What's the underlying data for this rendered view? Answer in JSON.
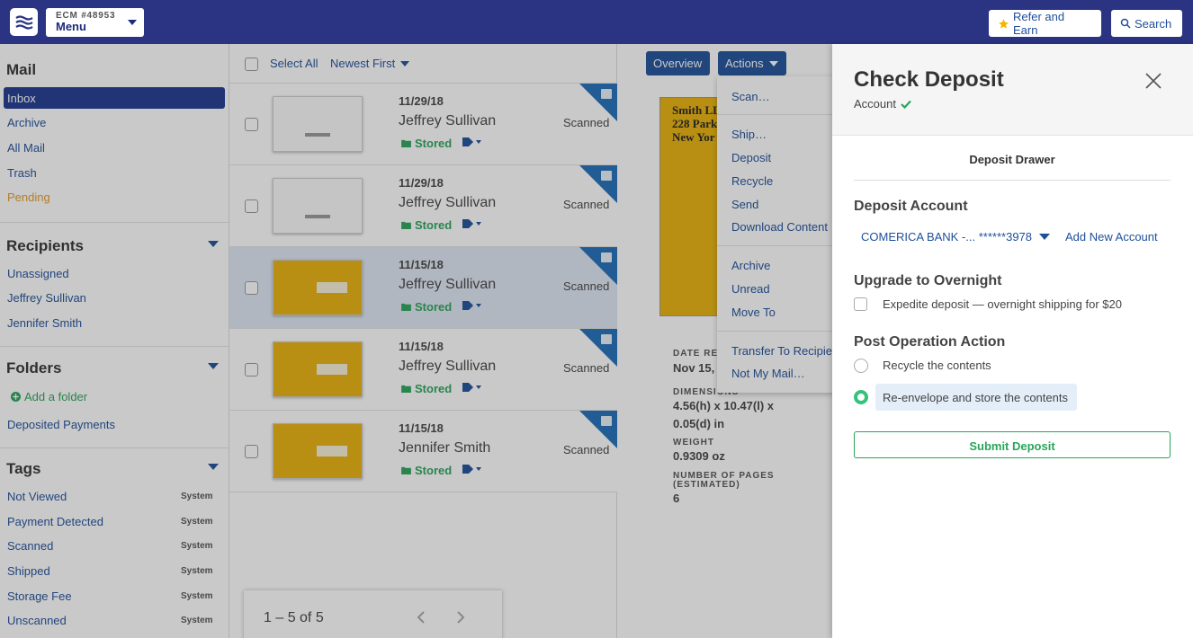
{
  "topbar": {
    "account_id": "ECM #48953",
    "menu_label": "Menu",
    "refer_label": "Refer and Earn",
    "search_label": "Search"
  },
  "sidebar": {
    "mail_title": "Mail",
    "mail_items": [
      "Inbox",
      "Archive",
      "All Mail",
      "Trash",
      "Pending"
    ],
    "recipients_title": "Recipients",
    "recipients": [
      "Unassigned",
      "Jeffrey Sullivan",
      "Jennifer Smith"
    ],
    "folders_title": "Folders",
    "add_folder": "Add a folder",
    "folders": [
      "Deposited Payments"
    ],
    "tags_title": "Tags",
    "tags": [
      {
        "name": "Not Viewed",
        "badge": "System"
      },
      {
        "name": "Payment Detected",
        "badge": "System"
      },
      {
        "name": "Scanned",
        "badge": "System"
      },
      {
        "name": "Shipped",
        "badge": "System"
      },
      {
        "name": "Storage Fee",
        "badge": "System"
      },
      {
        "name": "Unscanned",
        "badge": "System"
      }
    ]
  },
  "list": {
    "select_all": "Select All",
    "sort": "Newest First",
    "items": [
      {
        "date": "11/29/18",
        "name": "Jeffrey Sullivan",
        "storage": "Stored",
        "status": "Scanned"
      },
      {
        "date": "11/29/18",
        "name": "Jeffrey Sullivan",
        "storage": "Stored",
        "status": "Scanned"
      },
      {
        "date": "11/15/18",
        "name": "Jeffrey Sullivan",
        "storage": "Stored",
        "status": "Scanned"
      },
      {
        "date": "11/15/18",
        "name": "Jeffrey Sullivan",
        "storage": "Stored",
        "status": "Scanned"
      },
      {
        "date": "11/15/18",
        "name": "Jennifer Smith",
        "storage": "Stored",
        "status": "Scanned"
      }
    ],
    "pager": "1 – 5 of 5"
  },
  "detail": {
    "overview_label": "Overview",
    "actions_label": "Actions",
    "letter_lines": [
      "Smith LL",
      "228 Park",
      "New Yor"
    ],
    "date_label": "DATE RE",
    "date_value": "Nov 15,",
    "dimensions_label": "DIMENSIONS",
    "dimensions_value_1": "4.56(h) x 10.47(l) x",
    "dimensions_value_2": "0.05(d) in",
    "weight_label": "WEIGHT",
    "weight_value": "0.9309 oz",
    "pages_label_1": "NUMBER OF PAGES",
    "pages_label_2": "(ESTIMATED)",
    "pages_value": "6",
    "actions_menu": [
      "Scan…",
      "Ship…",
      "Deposit",
      "Recycle",
      "Send",
      "Download Content",
      "Archive",
      "Unread",
      "Move To",
      "Transfer To Recipient",
      "Not My Mail…"
    ]
  },
  "drawer": {
    "title": "Check Deposit",
    "subtitle": "Account",
    "section_title": "Deposit Drawer",
    "deposit_account_h": "Deposit Account",
    "account_select": "COMERICA BANK -... ******3978",
    "add_account": "Add New Account",
    "upgrade_h": "Upgrade to Overnight",
    "expedite_text": "Expedite deposit — overnight shipping for $20",
    "post_h": "Post Operation Action",
    "opt_recycle": "Recycle the contents",
    "opt_store": "Re-envelope and store the contents",
    "submit": "Submit Deposit"
  },
  "colors": {
    "topbar": "#2a3483",
    "link": "#1f4f9a",
    "accent_green": "#2aa55a",
    "pending": "#e39a2a"
  }
}
